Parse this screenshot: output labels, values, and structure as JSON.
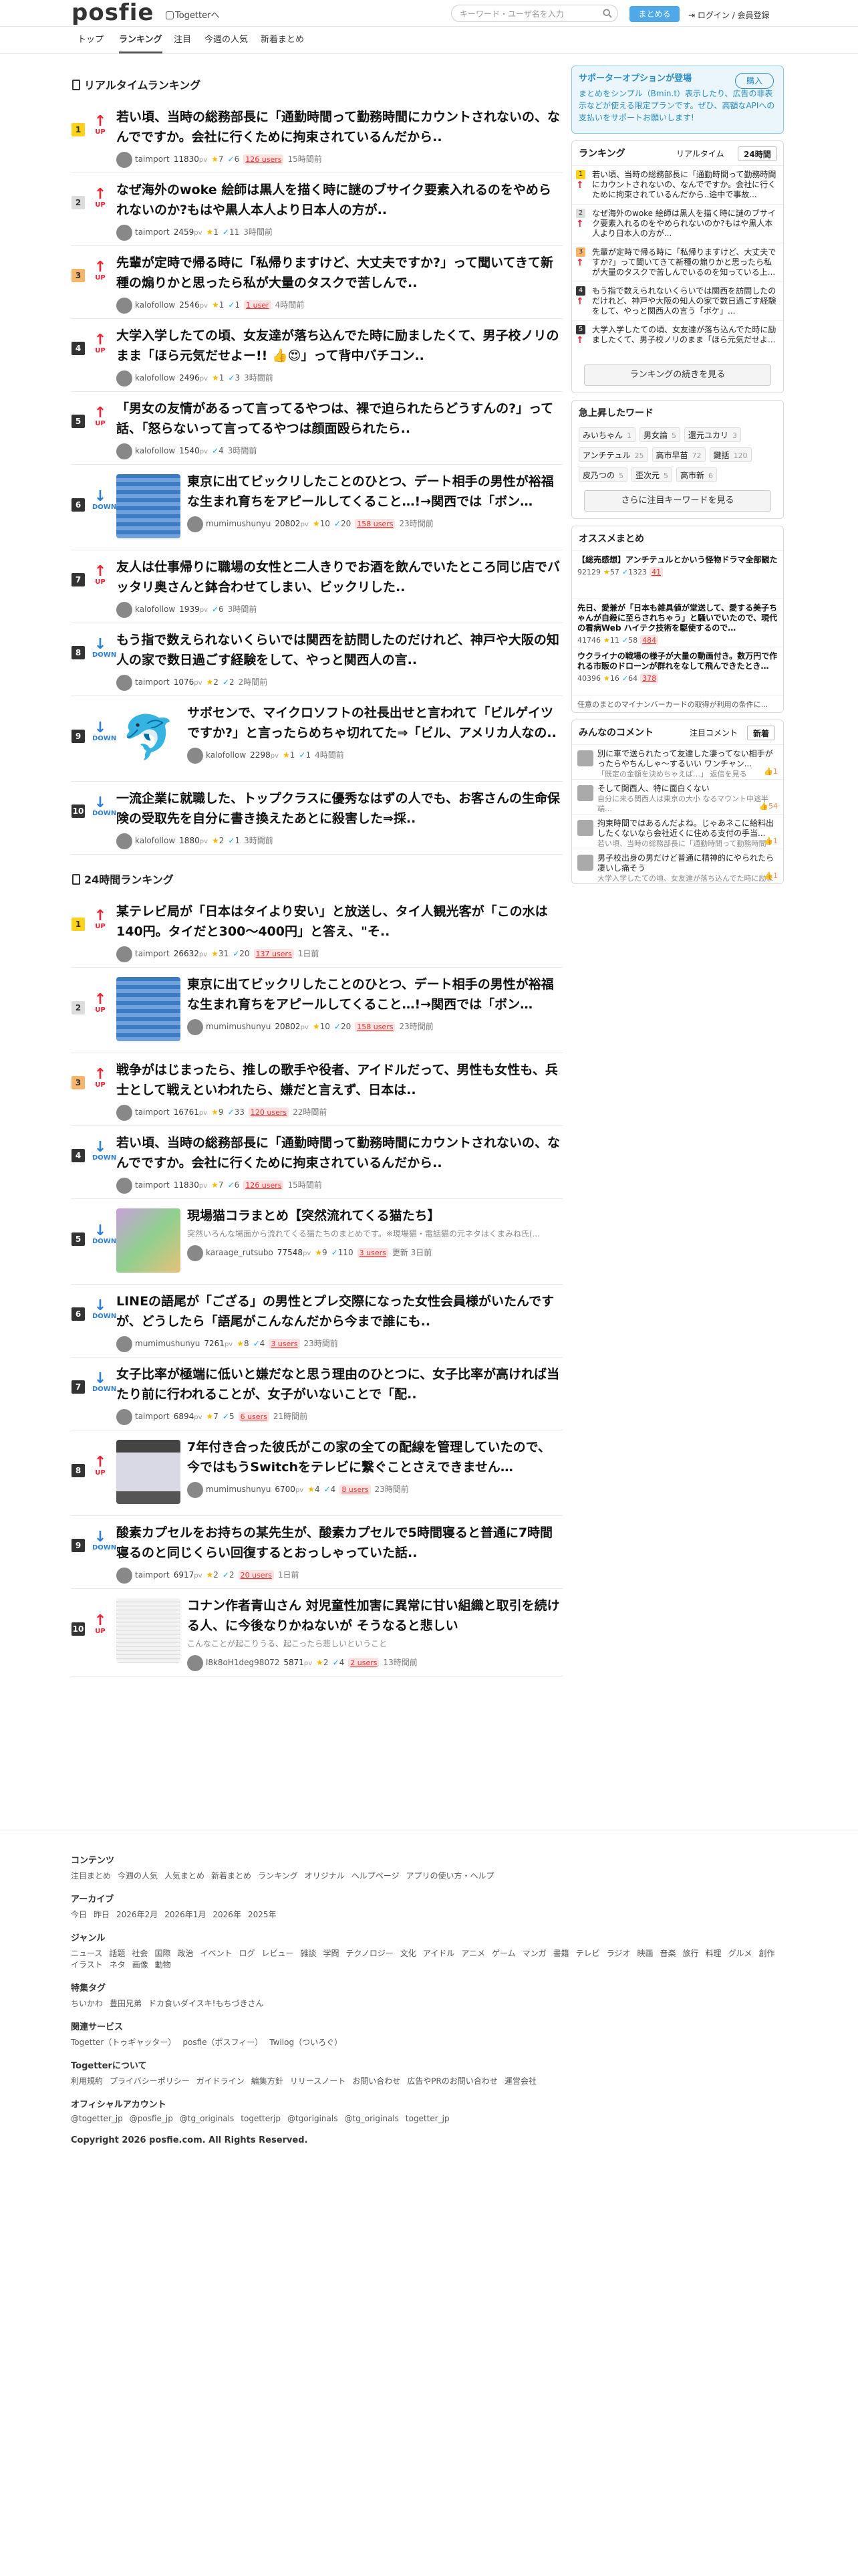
{
  "header": {
    "logo": "posfie",
    "togetter_link": "Togetterへ",
    "search_placeholder": "キーワード・ユーザ名を入力",
    "matome_button": "まとめる",
    "login": "ログイン / 会員登録"
  },
  "nav": {
    "tabs": [
      {
        "label": "トップ",
        "active": false
      },
      {
        "label": "ランキング",
        "active": true
      },
      {
        "label": "注目",
        "active": false
      },
      {
        "label": "今週の人気",
        "active": false
      },
      {
        "label": "新着まとめ",
        "active": false
      }
    ]
  },
  "realtime": {
    "heading": "リアルタイムランキング",
    "items": [
      {
        "rank": "1",
        "dir": "UP",
        "title": "若い頃、当時の総務部長に「通勤時間って勤務時間にカウントされないの、なんでですか。会社に行くために拘束されているんだから..",
        "user": "taimport",
        "pv": "11830",
        "likes": "7",
        "rt": "6",
        "users": "126 users",
        "time": "15時間前",
        "thumb": null,
        "sub": null
      },
      {
        "rank": "2",
        "dir": "UP",
        "title": "なぜ海外のwoke 絵師は黒人を描く時に謎のブサイク要素入れるのをやめられないのか?もはや黒人本人より日本人の方が..",
        "user": "taimport",
        "pv": "2459",
        "likes": "1",
        "rt": "11",
        "users": null,
        "time": "3時間前",
        "thumb": null,
        "sub": null
      },
      {
        "rank": "3",
        "dir": "UP",
        "title": "先輩が定時で帰る時に「私帰りますけど、大丈夫ですか?」って聞いてきて新種の煽りかと思ったら私が大量のタスクで苦しんで..",
        "user": "kalofollow",
        "pv": "2546",
        "likes": "1",
        "rt": "1",
        "users": "1 user",
        "time": "4時間前",
        "thumb": null,
        "sub": null
      },
      {
        "rank": "4",
        "dir": "UP",
        "title": "大学入学したての頃、女友達が落ち込んでた時に励ましたくて、男子校ノリのまま「ほら元気だせよー!! 👍😍」って背中バチコン..",
        "user": "kalofollow",
        "pv": "2496",
        "likes": "1",
        "rt": "3",
        "users": null,
        "time": "3時間前",
        "thumb": null,
        "sub": null
      },
      {
        "rank": "5",
        "dir": "UP",
        "title": "「男女の友情があるって言ってるやつは、裸で迫られたらどうすんの?」って話、「怒らないって言ってるやつは顔面殴られたら..",
        "user": "kalofollow",
        "pv": "1540",
        "likes": null,
        "rt": "4",
        "users": null,
        "time": "3時間前",
        "thumb": null,
        "sub": null
      },
      {
        "rank": "6",
        "dir": "DOWN",
        "title": "東京に出てビックリしたことのひとつ、デート相手の男性が裕福な生まれ育ちをアピールしてくること…!→関西では「ボン…",
        "user": "mumimushunyu",
        "pv": "20802",
        "likes": "10",
        "rt": "20",
        "users": "158 users",
        "time": "23時間前",
        "thumb": "table",
        "sub": null
      },
      {
        "rank": "7",
        "dir": "UP",
        "title": "友人は仕事帰りに職場の女性と二人きりでお酒を飲んでいたところ同じ店でバッタリ奥さんと鉢合わせてしまい、ビックリした..",
        "user": "kalofollow",
        "pv": "1939",
        "likes": null,
        "rt": "6",
        "users": null,
        "time": "3時間前",
        "thumb": null,
        "sub": null
      },
      {
        "rank": "8",
        "dir": "DOWN",
        "title": "もう指で数えられないくらいでは関西を訪問したのだけれど、神戸や大阪の知人の家で数日過ごす経験をして、やっと関西人の言..",
        "user": "taimport",
        "pv": "1076",
        "likes": "2",
        "rt": "2",
        "users": null,
        "time": "2時間前",
        "thumb": null,
        "sub": null
      },
      {
        "rank": "9",
        "dir": "DOWN",
        "title": "サボセンで、マイクロソフトの社長出せと言われて「ビルゲイツですか?」と言ったらめちゃ切れてた⇒「ビル、アメリカ人なの..",
        "user": "kalofollow",
        "pv": "2298",
        "likes": "1",
        "rt": "1",
        "users": null,
        "time": "4時間前",
        "thumb": "dolphin",
        "sub": null
      },
      {
        "rank": "10",
        "dir": "DOWN",
        "title": "一流企業に就職した、トップクラスに優秀なはずの人でも、お客さんの生命保険の受取先を自分に書き換えたあとに殺害した⇒採..",
        "user": "kalofollow",
        "pv": "1880",
        "likes": "2",
        "rt": "1",
        "users": null,
        "time": "3時間前",
        "thumb": null,
        "sub": null
      }
    ]
  },
  "daily": {
    "heading": "24時間ランキング",
    "items": [
      {
        "rank": "1",
        "dir": "UP",
        "title": "某テレビ局が「日本はタイより安い」と放送し、タイ人観光客が「この水は140円。タイだと300～400円」と答え、\"そ..",
        "user": "taimport",
        "pv": "26632",
        "likes": "31",
        "rt": "20",
        "users": "137 users",
        "time": "1日前",
        "thumb": null,
        "sub": null
      },
      {
        "rank": "2",
        "dir": "UP",
        "title": "東京に出てビックリしたことのひとつ、デート相手の男性が裕福な生まれ育ちをアピールしてくること…!→関西では「ボン…",
        "user": "mumimushunyu",
        "pv": "20802",
        "likes": "10",
        "rt": "20",
        "users": "158 users",
        "time": "23時間前",
        "thumb": "table",
        "sub": null
      },
      {
        "rank": "3",
        "dir": "UP",
        "title": "戦争がはじまったら、推しの歌手や役者、アイドルだって、男性も女性も、兵士として戦えといわれたら、嫌だと言えず、日本は..",
        "user": "taimport",
        "pv": "16761",
        "likes": "9",
        "rt": "33",
        "users": "120 users",
        "time": "22時間前",
        "thumb": null,
        "sub": null
      },
      {
        "rank": "4",
        "dir": "DOWN",
        "title": "若い頃、当時の総務部長に「通勤時間って勤務時間にカウントされないの、なんでですか。会社に行くために拘束されているんだから..",
        "user": "taimport",
        "pv": "11830",
        "likes": "7",
        "rt": "6",
        "users": "126 users",
        "time": "15時間前",
        "thumb": null,
        "sub": null
      },
      {
        "rank": "5",
        "dir": "DOWN",
        "title": "現場猫コラまとめ【突然流れてくる猫たち】",
        "user": "karaage_rutsubo",
        "pv": "77548",
        "likes": "9",
        "rt": "110",
        "users": "3 users",
        "time": "更新 3日前",
        "thumb": "cats",
        "sub": "突然いろんな場面から流れてくる猫たちのまとめです。※現場猫・電話猫の元ネタはくまみね氏(..."
      },
      {
        "rank": "6",
        "dir": "DOWN",
        "title": "LINEの語尾が「ござる」の男性とプレ交際になった女性会員様がいたんですが、どうしたら「語尾がこんなんだから今まで誰にも..",
        "user": "mumimushunyu",
        "pv": "7261",
        "likes": "8",
        "rt": "4",
        "users": "3 users",
        "time": "23時間前",
        "thumb": null,
        "sub": null
      },
      {
        "rank": "7",
        "dir": "DOWN",
        "title": "女子比率が極端に低いと嫌だなと思う理由のひとつに、女子比率が高ければ当たり前に行われることが、女子がいないことで「配..",
        "user": "taimport",
        "pv": "6894",
        "likes": "7",
        "rt": "5",
        "users": "6 users",
        "time": "21時間前",
        "thumb": null,
        "sub": null
      },
      {
        "rank": "8",
        "dir": "UP",
        "title": "7年付き合った彼氏がこの家の全ての配線を管理していたので、今ではもうSwitchをテレビに繋ぐことさえできません…",
        "user": "mumimushunyu",
        "pv": "6700",
        "likes": "4",
        "rt": "4",
        "users": "8 users",
        "time": "23時間前",
        "thumb": "tv",
        "sub": null
      },
      {
        "rank": "9",
        "dir": "DOWN",
        "title": "酸素カプセルをお持ちの某先生が、酸素カプセルで5時間寝ると普通に7時間寝るのと同じくらい回復するとおっしゃっていた話..",
        "user": "taimport",
        "pv": "6917",
        "likes": "2",
        "rt": "2",
        "users": "20 users",
        "time": "1日前",
        "thumb": null,
        "sub": null
      },
      {
        "rank": "10",
        "dir": "UP",
        "title": "コナン作者青山さん 対児童性加害に異常に甘い組織と取引を続ける人、に今後なりかねないが そうなると悲しい",
        "user": "l8k8oH1deg98072",
        "pv": "5871",
        "likes": "2",
        "rt": "4",
        "users": "2 users",
        "time": "13時間前",
        "thumb": "doc",
        "sub": "こんなことが起こりうる、起こったら悲しいということ"
      }
    ]
  },
  "side": {
    "promo": {
      "title": "サポーターオプションが登場",
      "buy": "購入",
      "line1": "まとめをシンプル（⁠Bmin.t）表示したり、広告の非表示などが使える限定プランです。ぜひ、高額なAPIへの支払いをサポートお願いします!"
    },
    "ranking": {
      "title": "ランキング",
      "tab_realtime": "リアルタイム",
      "tab_24h": "24時間",
      "rows": [
        {
          "rank": "1",
          "text": "若い頃、当時の総務部長に「通勤時間って勤務時間にカウントされないの、なんでですか。会社に行くために拘束されているんだから..途中で事故..."
        },
        {
          "rank": "2",
          "text": "なぜ海外のwoke 絵師は黒人を描く時に謎のブサイク要素入れるのをやめられないのか?もはや黒人本人より日本人の方が..."
        },
        {
          "rank": "3",
          "text": "先輩が定時で帰る時に「私帰りますけど、大丈夫ですか?」って聞いてきて新種の煽りかと思ったら私が大量のタスクで苦しんでいるのを知っている上..."
        },
        {
          "rank": "4",
          "text": "もう指で数えられないくらいでは関西を訪問したのだけれど、神戸や大阪の知人の家で数日過ごす経験をして、やっと関西人の言う「ボケ」..."
        },
        {
          "rank": "5",
          "text": "大学入学したての頃、女友達が落ち込んでた時に励ましたくて、男子校ノリのまま「ほら元気だせよ..."
        }
      ],
      "more": "ランキングの続きを見る"
    },
    "keywords": {
      "title": "急上昇したワード",
      "items": [
        {
          "w": "みいちゃん",
          "c": "1"
        },
        {
          "w": "男女論",
          "c": "5"
        },
        {
          "w": "還元ユカリ",
          "c": "3"
        },
        {
          "w": "アンチテュル",
          "c": "25"
        },
        {
          "w": "高市早苗",
          "c": "72"
        },
        {
          "w": "鍵括",
          "c": "120"
        },
        {
          "w": "皮乃つの",
          "c": "5"
        },
        {
          "w": "歪次元",
          "c": "5"
        },
        {
          "w": "高市新",
          "c": "6"
        }
      ],
      "more": "さらに注目キーワードを見る"
    },
    "osusume": {
      "title": "オススメまとめ",
      "rows": [
        {
          "t": "【総売感想】アンチテュルとかいう怪物ドラマ全部観た",
          "pv": "92129",
          "l": "57",
          "r": "1323",
          "u": "41"
        },
        {
          "t": "先日、愛兼が「日本も雑具値が堂送して、愛する美子ちゃんが自殺に至らされちゃう」と騒いでいたので、現代の看病Web ハイテク技術を駆使するので…",
          "pv": "41746",
          "l": "11",
          "r": "58",
          "u": "484"
        },
        {
          "t": "ウクライナの戦場の様子が大量の動画付き。数万円で作れる市販のドローンが群れをなして飛んできたとき…",
          "pv": "40396",
          "l": "16",
          "r": "64",
          "u": "378"
        }
      ],
      "tail": "任意のまとのマイナンバーカードの取得が利用の条件に..."
    },
    "comments": {
      "title": "みんなのコメント",
      "tab_hot": "注目コメント",
      "tab_new": "新着",
      "rows": [
        {
          "t": "別に車で送られたって友達した凄ってない相手がったらやちんしゃ〜するいい ワンチャン...",
          "s": "「既定の金額を決めちゃえば…」 返信を見る",
          "l": "1"
        },
        {
          "t": "そして関西人、特に面白くない",
          "s": "自分に来る関西人は東京の大小 なるマウント中途半端…",
          "l": "54"
        },
        {
          "t": "拘束時間ではあるんだよね。じゃあネこに給料出したくないなら会社近くに住める支付の手当...",
          "s": "若い頃、当時の総務部長に「通勤時間って勤務時間に...",
          "l": "1"
        },
        {
          "t": "男子校出身の男だけど普通に精神的にやられたら凄いし痛そう",
          "s": "大学入学したての頃、女友達が落ち込んでた時に励まし...",
          "l": "1"
        }
      ]
    }
  },
  "footer": {
    "sections": [
      {
        "h": "コンテンツ",
        "links": [
          "注目まとめ",
          "今週の人気",
          "人気まとめ",
          "新着まとめ",
          "ランキング",
          "オリジナル",
          "ヘルプページ",
          "アプリの使い方・ヘルプ"
        ]
      },
      {
        "h": "アーカイブ",
        "links": [
          "今日",
          "昨日",
          "2026年2月",
          "2026年1月",
          "2026年",
          "2025年"
        ]
      },
      {
        "h": "ジャンル",
        "links": [
          "ニュース",
          "話題",
          "社会",
          "国際",
          "政治",
          "イベント",
          "ログ",
          "レビュー",
          "雑談",
          "学問",
          "テクノロジー",
          "文化",
          "アイドル",
          "アニメ",
          "ゲーム",
          "マンガ",
          "書籍",
          "テレビ",
          "ラジオ",
          "映画",
          "音楽",
          "旅行",
          "料理",
          "グルメ",
          "創作",
          "イラスト",
          "ネタ",
          "画像",
          "動物"
        ]
      },
      {
        "h": "特集タグ",
        "links": [
          "ちいかわ",
          "豊田兄弟",
          "ドカ食いダイスキ!もちづきさん"
        ]
      },
      {
        "h": "関連サービス",
        "links": [
          "Togetter（トゥギャッター）",
          "posfie（ポスフィー）",
          "Twilog（ついろぐ）"
        ]
      },
      {
        "h": "Togetterについて",
        "links": [
          "利用規約",
          "プライバシーポリシー",
          "ガイドライン",
          "編集方針",
          "リリースノート",
          "お問い合わせ",
          "広告やPRのお問い合わせ",
          "運営会社"
        ]
      },
      {
        "h": "オフィシャルアカウント",
        "links": [
          "@togetter_jp",
          "@posfie_jp",
          "@tg_originals",
          "togetterjp",
          "@tgoriginals",
          "@tg_originals",
          "togetter_jp"
        ]
      }
    ],
    "copyright": "Copyright 2026 posfie.com. All Rights Reserved."
  }
}
